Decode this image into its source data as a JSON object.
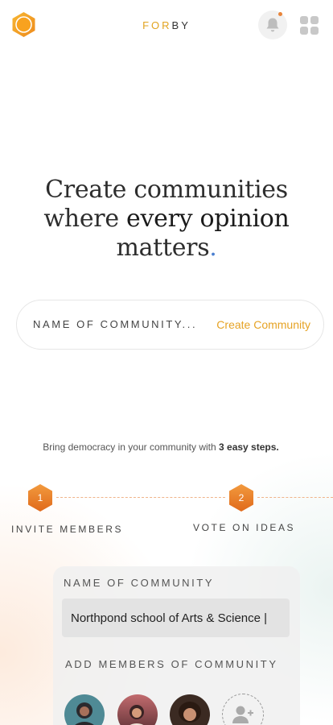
{
  "header": {
    "brand_part1": "FOR",
    "brand_part2": "BY",
    "icons": [
      "hexagon-logo-icon",
      "bell-icon",
      "grid-icon"
    ]
  },
  "hero": {
    "line1": "Create communities",
    "line2_a": "where",
    "line2_b": "every opinion",
    "line3": "matters",
    "line3_dot": "."
  },
  "create": {
    "placeholder": "NAME OF COMMUNITY...",
    "button_label": "Create Community"
  },
  "steps": {
    "intro_text": "Bring democracy in your community with ",
    "intro_bold": "3 easy steps.",
    "items": [
      {
        "number": "1",
        "label": "INVITE MEMBERS"
      },
      {
        "number": "2",
        "label": "VOTE ON IDEAS"
      }
    ]
  },
  "form": {
    "name_label": "NAME OF COMMUNITY",
    "name_value": "Northpond school of Arts & Science |",
    "members_label": "ADD MEMBERS OF COMMUNITY"
  },
  "colors": {
    "accent_orange": "#e8843a",
    "brand_gold": "#e2a31f",
    "link": "#e6a325"
  }
}
